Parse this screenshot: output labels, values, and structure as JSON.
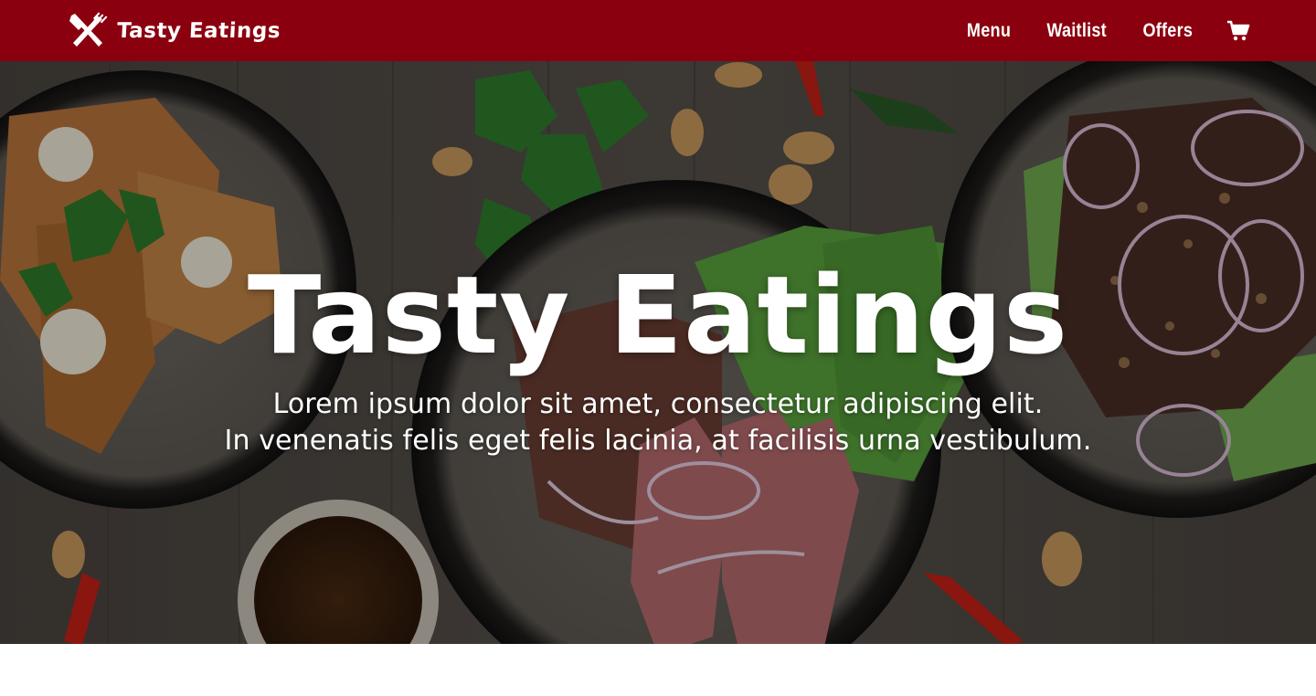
{
  "colors": {
    "navbar_bg": "#8b000e",
    "text": "#ffffff",
    "page_bg": "#ffffff"
  },
  "navbar": {
    "brand_icon": "fork-knife-crossed-icon",
    "brand_name": "Tasty Eatings",
    "links": [
      {
        "label": "Menu"
      },
      {
        "label": "Waitlist"
      },
      {
        "label": "Offers"
      }
    ],
    "cart_icon": "shopping-cart-icon"
  },
  "hero": {
    "background": "food-table-photo",
    "title": "Tasty Eatings",
    "subtitle_lines": [
      "Lorem ipsum dolor sit amet, consectetur adipiscing elit.",
      "In venenatis felis eget felis lacinia, at facilisis urna vestibulum."
    ]
  }
}
